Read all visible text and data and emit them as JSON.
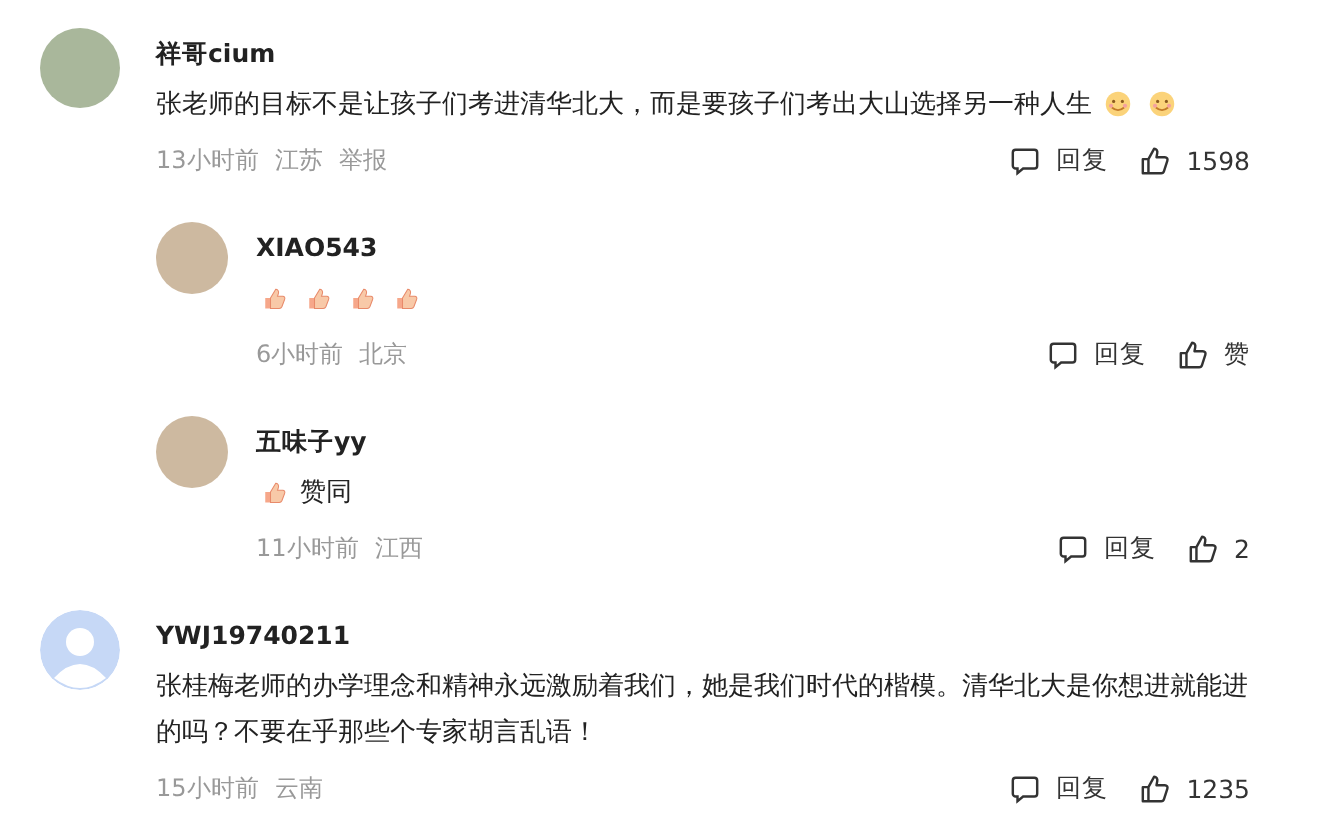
{
  "comments": [
    {
      "avatar": {
        "kind": "photo"
      },
      "name": "祥哥cium",
      "text": "张老师的目标不是让孩子们考进清华北大，而是要孩子们考出大山选择另一种人生",
      "emojis_after": [
        {
          "kind": "smile"
        },
        {
          "kind": "smile"
        }
      ],
      "time": "13小时前",
      "location": "江苏",
      "report": "举报",
      "reply_label": "回复",
      "like_label": "1598",
      "replies": [
        {
          "avatar": {
            "kind": "photo"
          },
          "name": "XIAO543",
          "emojis_before": [
            {
              "kind": "thumbs"
            },
            {
              "kind": "thumbs"
            },
            {
              "kind": "thumbs"
            },
            {
              "kind": "thumbs"
            }
          ],
          "time": "6小时前",
          "location": "北京",
          "reply_label": "回复",
          "like_label": "赞"
        },
        {
          "avatar": {
            "kind": "photo"
          },
          "name": "五味子yy",
          "text": "赞同",
          "emojis_before": [
            {
              "kind": "thumbs"
            }
          ],
          "time": "11小时前",
          "location": "江西",
          "reply_label": "回复",
          "like_label": "2"
        }
      ]
    },
    {
      "avatar": {
        "kind": "default"
      },
      "name": "YWJ19740211",
      "text": "张桂梅老师的办学理念和精神永远激励着我们，她是我们时代的楷模。清华北大是你想进就能进的吗？不要在乎那些个专家胡言乱语！",
      "time": "15小时前",
      "location": "云南",
      "reply_label": "回复",
      "like_label": "1235"
    }
  ]
}
